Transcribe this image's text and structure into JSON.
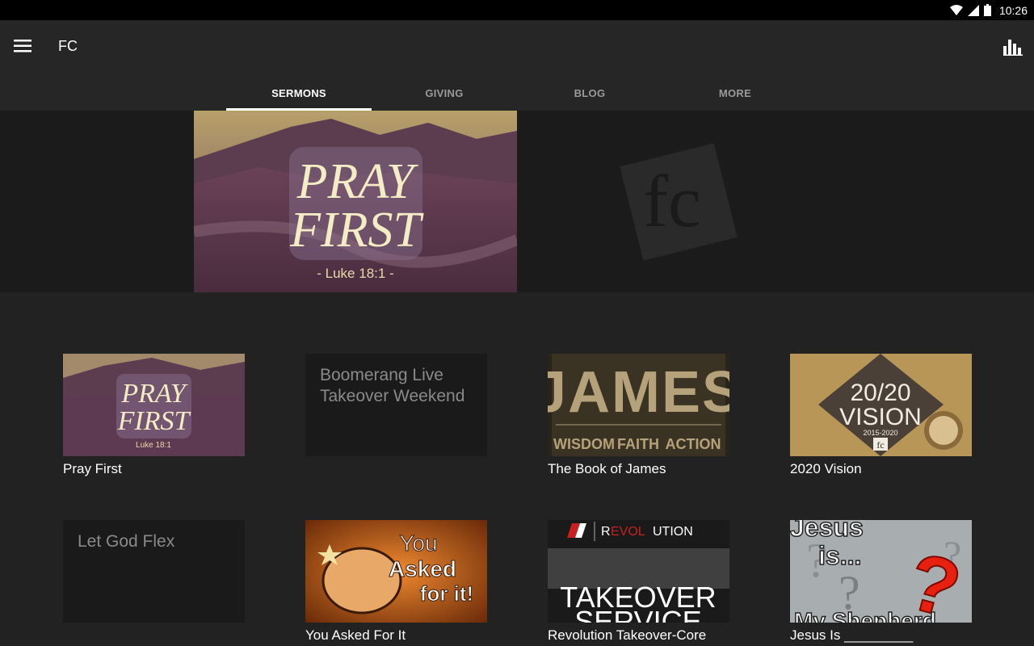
{
  "status_bar": {
    "time": "10:26",
    "icons": [
      "wifi-icon",
      "cell-signal-icon",
      "battery-icon"
    ]
  },
  "app_bar": {
    "title": "FC",
    "menu_icon": "hamburger-menu-icon",
    "action_icon": "bar-chart-icon"
  },
  "tabs": [
    {
      "label": "SERMONS",
      "active": true
    },
    {
      "label": "GIVING",
      "active": false
    },
    {
      "label": "BLOG",
      "active": false
    },
    {
      "label": "MORE",
      "active": false
    }
  ],
  "hero": {
    "image_title_line1": "PRAY",
    "image_title_line2": "FIRST",
    "image_reference": "- Luke 18:1 -",
    "logo_text": "fc"
  },
  "sermons": [
    {
      "title": "Pray First",
      "thumb_type": "image",
      "thumb_line1": "PRAY",
      "thumb_line2": "FIRST",
      "thumb_line3": "Luke 18:1"
    },
    {
      "title": "",
      "thumb_type": "placeholder",
      "placeholder_text": "Boomerang Live Takeover Weekend"
    },
    {
      "title": "The Book of James",
      "thumb_type": "image",
      "thumb_line1": "JAMES",
      "thumb_line2": "WISDOM",
      "thumb_line3": "FAITH",
      "thumb_line4": "ACTION"
    },
    {
      "title": "2020 Vision",
      "thumb_type": "image",
      "thumb_line1": "20/20",
      "thumb_line2": "VISION",
      "thumb_line3": "2015-2020",
      "thumb_line4": "fc"
    },
    {
      "title": "",
      "thumb_type": "placeholder",
      "placeholder_text": "Let God Flex"
    },
    {
      "title": "You Asked For It",
      "thumb_type": "image",
      "thumb_line1": "You",
      "thumb_line2": "Asked",
      "thumb_line3": "for it!"
    },
    {
      "title": "Revolution Takeover-Core",
      "thumb_type": "image",
      "thumb_line1": "R",
      "thumb_line2": "EVOL",
      "thumb_line3": "UTION",
      "thumb_line4": "TAKEOVER",
      "thumb_line5": "SERVICE"
    },
    {
      "title": "Jesus Is _________",
      "thumb_type": "image",
      "thumb_line1": "Jesus",
      "thumb_line2": "is...",
      "thumb_line3": "My Shepherd"
    }
  ],
  "colors": {
    "background": "#222222",
    "app_bar": "#262626",
    "hero_bg": "#1b1b1b",
    "tab_inactive": "#9a9a9a",
    "tab_active": "#ffffff"
  }
}
